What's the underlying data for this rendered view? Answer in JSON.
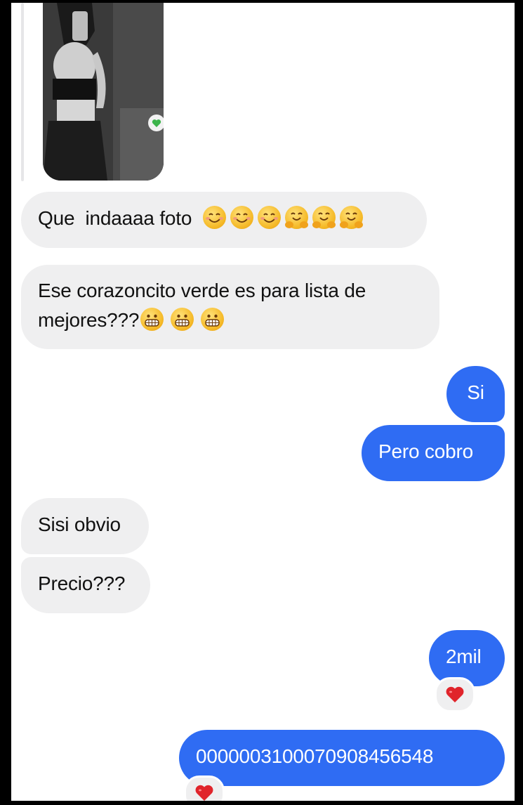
{
  "conversation": {
    "messages": [
      {
        "id": "m1",
        "direction": "incoming",
        "text": "Que  indaaaa foto",
        "emojis": [
          "smiling-face-with-smiling-eyes",
          "smiling-face-with-smiling-eyes",
          "smiling-face-with-smiling-eyes",
          "hugging-face",
          "hugging-face",
          "hugging-face"
        ]
      },
      {
        "id": "m2",
        "direction": "incoming",
        "line1": "Ese corazoncito verde es para lista de",
        "line2": "mejores???",
        "emojis": [
          "grimacing-face",
          "grimacing-face",
          "grimacing-face"
        ]
      },
      {
        "id": "m3",
        "direction": "outgoing",
        "text": "Si"
      },
      {
        "id": "m4",
        "direction": "outgoing",
        "text": "Pero cobro"
      },
      {
        "id": "m5",
        "direction": "incoming",
        "text": "Sisi obvio"
      },
      {
        "id": "m6",
        "direction": "incoming",
        "text": "Precio???"
      },
      {
        "id": "m7",
        "direction": "outgoing",
        "text": "2mil",
        "reaction": "red-heart"
      },
      {
        "id": "m8",
        "direction": "outgoing",
        "text": "0000003100070908456548",
        "reaction": "red-heart"
      }
    ],
    "replied_photo": {
      "badge_icon": "green-heart-icon"
    }
  },
  "colors": {
    "outgoing_bubble": "#2f6cf3",
    "incoming_bubble": "#efeff0",
    "background": "#ffffff",
    "reaction_heart": "#e0242b",
    "badge_heart": "#3cb44b"
  }
}
